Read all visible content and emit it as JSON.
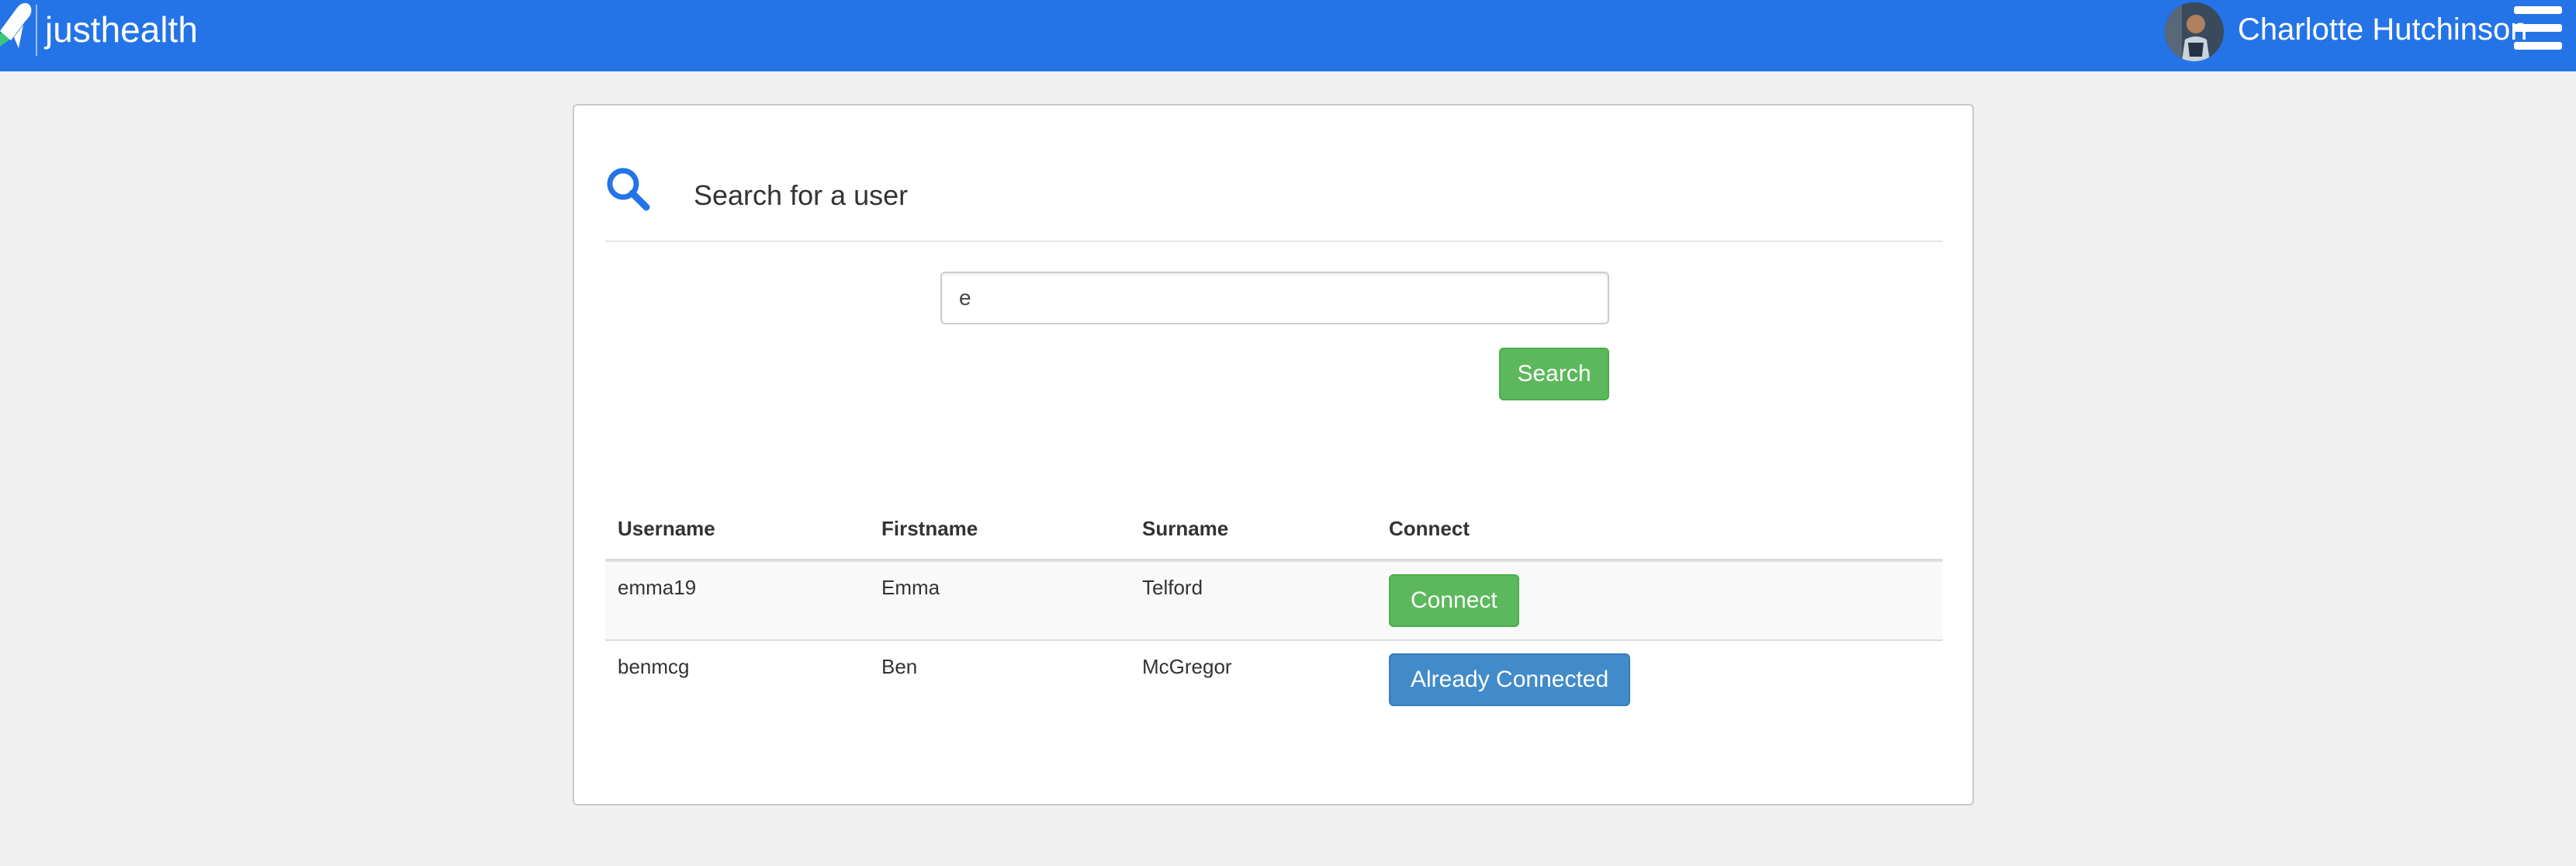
{
  "navbar": {
    "brand": "justhealth",
    "user_name": "Charlotte Hutchinson",
    "logo_icon": "justhealth-logo-icon",
    "menu_icon": "hamburger-menu-icon",
    "color": "#2474e8"
  },
  "panel": {
    "title": "Search for a user",
    "title_icon": "search-icon",
    "accent": "#2474e8"
  },
  "search": {
    "value": "e",
    "button_label": "Search"
  },
  "table": {
    "headers": {
      "username": "Username",
      "firstname": "Firstname",
      "surname": "Surname",
      "connect": "Connect"
    },
    "rows": [
      {
        "username": "emma19",
        "firstname": "Emma",
        "surname": "Telford",
        "action": "Connect"
      },
      {
        "username": "benmcg",
        "firstname": "Ben",
        "surname": "McGregor",
        "action": "Already Connected"
      }
    ]
  },
  "colors": {
    "success": "#5cb85c",
    "primary": "#428bca"
  }
}
